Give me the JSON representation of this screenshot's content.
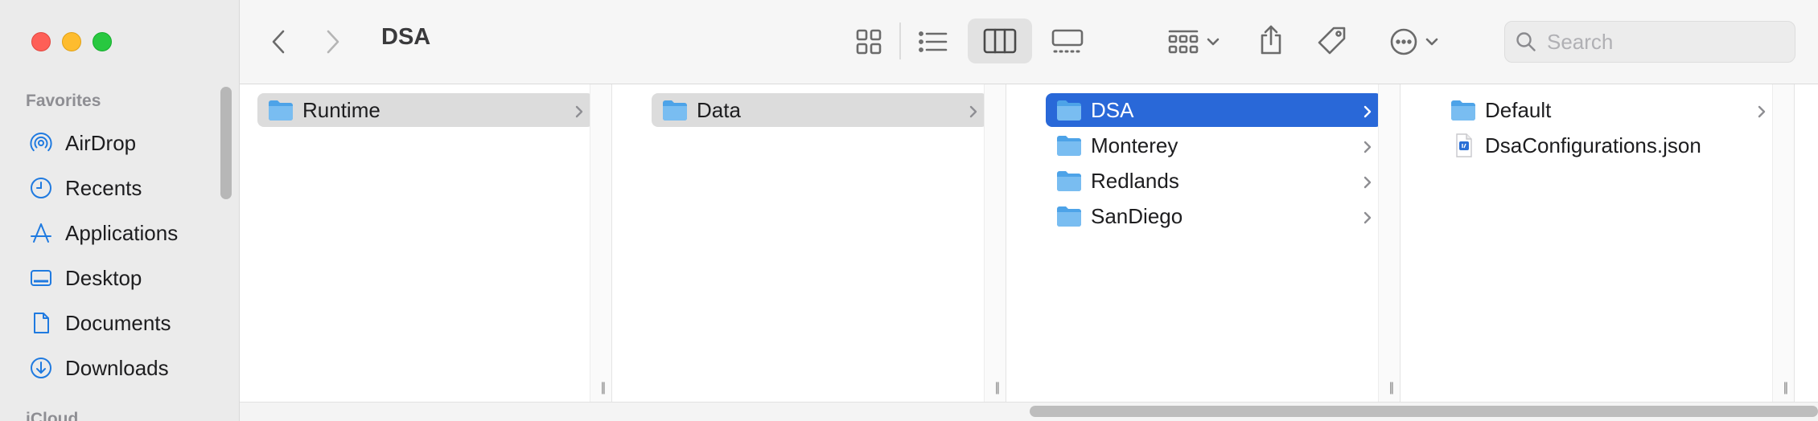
{
  "window": {
    "title": "DSA"
  },
  "sidebar": {
    "section_favorites": "Favorites",
    "section_icloud": "iCloud",
    "items": [
      {
        "label": "AirDrop",
        "icon": "airdrop-icon"
      },
      {
        "label": "Recents",
        "icon": "clock-icon"
      },
      {
        "label": "Applications",
        "icon": "applications-icon"
      },
      {
        "label": "Desktop",
        "icon": "desktop-icon"
      },
      {
        "label": "Documents",
        "icon": "document-icon"
      },
      {
        "label": "Downloads",
        "icon": "download-icon"
      }
    ]
  },
  "toolbar": {
    "search_placeholder": "Search",
    "active_view": "columns"
  },
  "columns": [
    {
      "items": [
        {
          "label": "Runtime",
          "type": "folder",
          "state": "parent"
        }
      ]
    },
    {
      "items": [
        {
          "label": "Data",
          "type": "folder",
          "state": "parent"
        }
      ]
    },
    {
      "items": [
        {
          "label": "DSA",
          "type": "folder",
          "state": "selected"
        },
        {
          "label": "Monterey",
          "type": "folder"
        },
        {
          "label": "Redlands",
          "type": "folder"
        },
        {
          "label": "SanDiego",
          "type": "folder"
        }
      ]
    },
    {
      "items": [
        {
          "label": "Default",
          "type": "folder"
        },
        {
          "label": "DsaConfigurations.json",
          "type": "json-file"
        }
      ]
    }
  ],
  "colors": {
    "accent": "#2968d8",
    "folder": "#5fb0ee",
    "icon_blue": "#1f7ae0"
  }
}
